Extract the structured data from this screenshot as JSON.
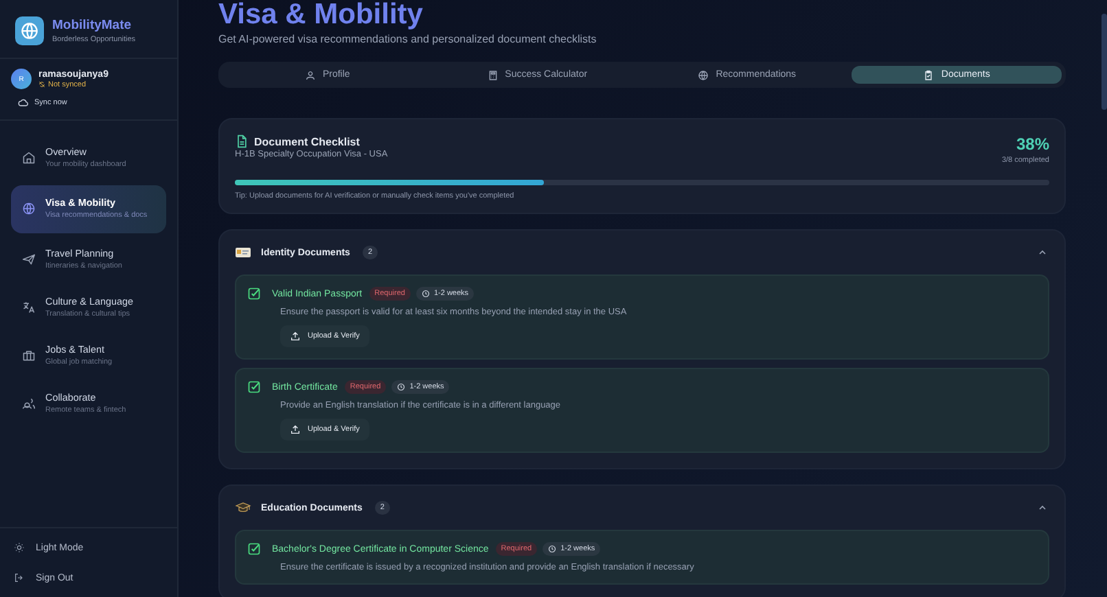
{
  "app": {
    "name": "MobilityMate",
    "tagline": "Borderless Opportunities"
  },
  "user": {
    "initial": "R",
    "name": "ramasoujanya9",
    "sync_status": "Not synced",
    "sync_action": "Sync now"
  },
  "nav": [
    {
      "label": "Overview",
      "sub": "Your mobility dashboard",
      "selected": false
    },
    {
      "label": "Visa & Mobility",
      "sub": "Visa recommendations & docs",
      "selected": true
    },
    {
      "label": "Travel Planning",
      "sub": "Itineraries & navigation",
      "selected": false
    },
    {
      "label": "Culture & Language",
      "sub": "Translation & cultural tips",
      "selected": false
    },
    {
      "label": "Jobs & Talent",
      "sub": "Global job matching",
      "selected": false
    },
    {
      "label": "Collaborate",
      "sub": "Remote teams & fintech",
      "selected": false
    }
  ],
  "footer_actions": [
    {
      "label": "Light Mode"
    },
    {
      "label": "Sign Out"
    }
  ],
  "page": {
    "title": "Visa & Mobility",
    "subtitle": "Get AI-powered visa recommendations and personalized document checklists"
  },
  "tabs": [
    {
      "label": "Profile",
      "selected": false
    },
    {
      "label": "Success Calculator",
      "selected": false
    },
    {
      "label": "Recommendations",
      "selected": false
    },
    {
      "label": "Documents",
      "selected": true
    }
  ],
  "checklist": {
    "title": "Document Checklist",
    "subtitle": "H-1B Specialty Occupation Visa - USA",
    "percent": "38%",
    "count": "3/8 completed",
    "level": 0.38,
    "tip": "Tip: Upload documents for AI verification or manually check items you've completed"
  },
  "sections": [
    {
      "title": "Identity Documents",
      "count": "2",
      "expanded": true,
      "items": [
        {
          "name": "Valid Indian Passport",
          "tag": "Required",
          "time": "1-2 weeks",
          "description": "Ensure the passport is valid for at least six months beyond the intended stay in the USA",
          "checked": true,
          "action": "Upload & Verify"
        },
        {
          "name": "Birth Certificate",
          "tag": "Required",
          "time": "1-2 weeks",
          "description": "Provide an English translation if the certificate is in a different language",
          "checked": true,
          "action": "Upload & Verify"
        }
      ]
    },
    {
      "title": "Education Documents",
      "count": "2",
      "expanded": true,
      "items": [
        {
          "name": "Bachelor's Degree Certificate in Computer Science",
          "tag": "Required",
          "time": "1-2 weeks",
          "description": "Ensure the certificate is issued by a recognized institution and provide an English translation if necessary",
          "checked": true
        }
      ]
    }
  ]
}
